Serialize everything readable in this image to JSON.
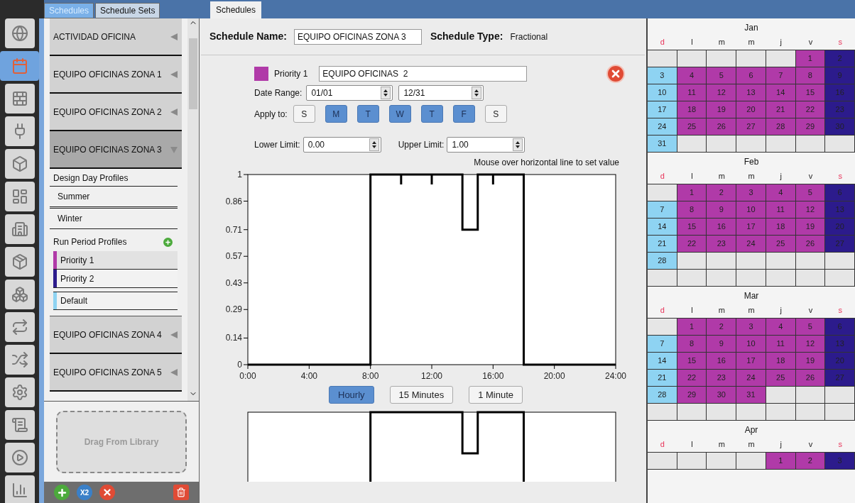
{
  "nav": [
    {
      "kind": "globe",
      "selected": false
    },
    {
      "kind": "calendar",
      "selected": true
    },
    {
      "kind": "bricks",
      "selected": false
    },
    {
      "kind": "outlet",
      "selected": false
    },
    {
      "kind": "cube",
      "selected": false
    },
    {
      "kind": "floorplan",
      "selected": false
    },
    {
      "kind": "building",
      "selected": false
    },
    {
      "kind": "box",
      "selected": false
    },
    {
      "kind": "boxes",
      "selected": false
    },
    {
      "kind": "loop",
      "selected": false
    },
    {
      "kind": "shuffle",
      "selected": false
    },
    {
      "kind": "gear",
      "selected": false
    },
    {
      "kind": "scroll",
      "selected": false
    },
    {
      "kind": "play",
      "selected": false
    },
    {
      "kind": "chart",
      "selected": false
    }
  ],
  "left_tabs": [
    {
      "label": "Schedules",
      "selected": true
    },
    {
      "label": "Schedule Sets",
      "selected": false
    }
  ],
  "main_tabs": [
    {
      "label": "Schedules",
      "selected": true
    }
  ],
  "schedules": [
    {
      "name": "ACTIVIDAD OFICINA",
      "expanded": false
    },
    {
      "name": "EQUIPO OFICINAS ZONA 1",
      "expanded": false
    },
    {
      "name": "EQUIPO OFICINAS ZONA 2",
      "expanded": false
    },
    {
      "name": "EQUIPO OFICINAS ZONA 3",
      "expanded": true,
      "design_day": {
        "label": "Design Day Profiles",
        "items": [
          "Summer",
          "Winter"
        ]
      },
      "run_period": {
        "label": "Run Period Profiles",
        "items": [
          {
            "label": "Priority 1",
            "color": "#b03aa8",
            "selected": true
          },
          {
            "label": "Priority 2",
            "color": "#2c1b8c",
            "selected": false
          },
          {
            "label": "Default",
            "color": "#8ed3f2",
            "selected": false
          }
        ]
      }
    },
    {
      "name": "EQUIPO OFICINAS ZONA 4",
      "expanded": false
    },
    {
      "name": "EQUIPO OFICINAS ZONA 5",
      "expanded": false
    }
  ],
  "library_drop": {
    "label": "Drag From Library"
  },
  "toolbar": [
    {
      "kind": "add"
    },
    {
      "kind": "copy",
      "label": "X2"
    },
    {
      "kind": "remove"
    },
    {
      "kind": "purge"
    }
  ],
  "editor": {
    "name_label": "Schedule Name:",
    "name_value": "EQUIPO OFICINAS ZONA 3",
    "type_label": "Schedule Type:",
    "type_value": "Fractional",
    "rule": {
      "color": "#b03aa8",
      "priority": "Priority 1",
      "name": "EQUIPO OFICINAS  2",
      "date_label": "Date Range:",
      "start": "01/01",
      "end": "12/31",
      "apply_label": "Apply to:",
      "days": [
        {
          "label": "S",
          "selected": false
        },
        {
          "label": "M",
          "selected": true
        },
        {
          "label": "T",
          "selected": true
        },
        {
          "label": "W",
          "selected": true
        },
        {
          "label": "T",
          "selected": true
        },
        {
          "label": "F",
          "selected": true
        },
        {
          "label": "S",
          "selected": false
        }
      ]
    },
    "lower_label": "Lower Limit:",
    "lower_value": "0.00",
    "upper_label": "Upper Limit:",
    "upper_value": "1.00",
    "hint": "Mouse over horizontal line to set value",
    "chart_data": {
      "type": "line",
      "x": [
        0,
        8,
        8,
        10,
        12,
        14,
        14,
        15,
        15,
        16,
        18,
        18,
        24
      ],
      "series": [
        {
          "color": "#000000",
          "values": [
            0,
            0,
            1,
            1,
            1,
            1,
            0.71,
            0.71,
            1,
            1,
            1,
            0,
            0
          ]
        }
      ],
      "xlim": [
        0,
        24
      ],
      "ylim": [
        0,
        1
      ],
      "xticks": [
        {
          "value": 0,
          "label": "0:00"
        },
        {
          "value": 4,
          "label": "4:00"
        },
        {
          "value": 8,
          "label": "8:00"
        },
        {
          "value": 12,
          "label": "12:00"
        },
        {
          "value": 16,
          "label": "16:00"
        },
        {
          "value": 20,
          "label": "20:00"
        },
        {
          "value": 24,
          "label": "24:00"
        }
      ],
      "yticks": [
        {
          "value": 0,
          "label": "0"
        },
        {
          "value": 0.14,
          "label": "0.14"
        },
        {
          "value": 0.29,
          "label": "0.29"
        },
        {
          "value": 0.43,
          "label": "0.43"
        },
        {
          "value": 0.57,
          "label": "0.57"
        },
        {
          "value": 0.71,
          "label": "0.71"
        },
        {
          "value": 0.86,
          "label": "0.86"
        },
        {
          "value": 1,
          "label": "1"
        }
      ]
    },
    "resolutions": [
      {
        "label": "Hourly",
        "selected": true
      },
      {
        "label": "15 Minutes",
        "selected": false
      },
      {
        "label": "1 Minute",
        "selected": false
      }
    ]
  },
  "calendar": [
    {
      "month": "Jan",
      "weekdays": [
        {
          "label": "d",
          "weekend": true
        },
        {
          "label": "l",
          "weekend": false
        },
        {
          "label": "m",
          "weekend": false
        },
        {
          "label": "m",
          "weekend": false
        },
        {
          "label": "j",
          "weekend": false
        },
        {
          "label": "v",
          "weekend": false
        },
        {
          "label": "s",
          "weekend": true
        }
      ],
      "weeks": [
        [
          {
            "kind": "empty"
          },
          {
            "kind": "empty"
          },
          {
            "kind": "empty"
          },
          {
            "kind": "empty"
          },
          {
            "kind": "empty"
          },
          {
            "kind": "day",
            "day": "1",
            "color": "#b03aa8"
          },
          {
            "kind": "day",
            "day": "2",
            "color": "#2c1b8c"
          }
        ],
        [
          {
            "kind": "day",
            "day": "3",
            "color": "#8ed3f2"
          },
          {
            "kind": "day",
            "day": "4",
            "color": "#b03aa8"
          },
          {
            "kind": "day",
            "day": "5",
            "color": "#b03aa8"
          },
          {
            "kind": "day",
            "day": "6",
            "color": "#b03aa8"
          },
          {
            "kind": "day",
            "day": "7",
            "color": "#b03aa8"
          },
          {
            "kind": "day",
            "day": "8",
            "color": "#b03aa8"
          },
          {
            "kind": "day",
            "day": "9",
            "color": "#2c1b8c"
          }
        ],
        [
          {
            "kind": "day",
            "day": "10",
            "color": "#8ed3f2"
          },
          {
            "kind": "day",
            "day": "11",
            "color": "#b03aa8"
          },
          {
            "kind": "day",
            "day": "12",
            "color": "#b03aa8"
          },
          {
            "kind": "day",
            "day": "13",
            "color": "#b03aa8"
          },
          {
            "kind": "day",
            "day": "14",
            "color": "#b03aa8"
          },
          {
            "kind": "day",
            "day": "15",
            "color": "#b03aa8"
          },
          {
            "kind": "day",
            "day": "16",
            "color": "#2c1b8c"
          }
        ],
        [
          {
            "kind": "day",
            "day": "17",
            "color": "#8ed3f2"
          },
          {
            "kind": "day",
            "day": "18",
            "color": "#b03aa8"
          },
          {
            "kind": "day",
            "day": "19",
            "color": "#b03aa8"
          },
          {
            "kind": "day",
            "day": "20",
            "color": "#b03aa8"
          },
          {
            "kind": "day",
            "day": "21",
            "color": "#b03aa8"
          },
          {
            "kind": "day",
            "day": "22",
            "color": "#b03aa8"
          },
          {
            "kind": "day",
            "day": "23",
            "color": "#2c1b8c"
          }
        ],
        [
          {
            "kind": "day",
            "day": "24",
            "color": "#8ed3f2"
          },
          {
            "kind": "day",
            "day": "25",
            "color": "#b03aa8"
          },
          {
            "kind": "day",
            "day": "26",
            "color": "#b03aa8"
          },
          {
            "kind": "day",
            "day": "27",
            "color": "#b03aa8"
          },
          {
            "kind": "day",
            "day": "28",
            "color": "#b03aa8"
          },
          {
            "kind": "day",
            "day": "29",
            "color": "#b03aa8"
          },
          {
            "kind": "day",
            "day": "30",
            "color": "#2c1b8c"
          }
        ],
        [
          {
            "kind": "day",
            "day": "31",
            "color": "#8ed3f2"
          },
          {
            "kind": "empty"
          },
          {
            "kind": "empty"
          },
          {
            "kind": "empty"
          },
          {
            "kind": "empty"
          },
          {
            "kind": "empty"
          },
          {
            "kind": "empty"
          }
        ]
      ]
    },
    {
      "month": "Feb",
      "weekdays": [
        {
          "label": "d",
          "weekend": true
        },
        {
          "label": "l",
          "weekend": false
        },
        {
          "label": "m",
          "weekend": false
        },
        {
          "label": "m",
          "weekend": false
        },
        {
          "label": "j",
          "weekend": false
        },
        {
          "label": "v",
          "weekend": false
        },
        {
          "label": "s",
          "weekend": true
        }
      ],
      "weeks": [
        [
          {
            "kind": "empty"
          },
          {
            "kind": "day",
            "day": "1",
            "color": "#b03aa8"
          },
          {
            "kind": "day",
            "day": "2",
            "color": "#b03aa8"
          },
          {
            "kind": "day",
            "day": "3",
            "color": "#b03aa8"
          },
          {
            "kind": "day",
            "day": "4",
            "color": "#b03aa8"
          },
          {
            "kind": "day",
            "day": "5",
            "color": "#b03aa8"
          },
          {
            "kind": "day",
            "day": "6",
            "color": "#2c1b8c"
          }
        ],
        [
          {
            "kind": "day",
            "day": "7",
            "color": "#8ed3f2"
          },
          {
            "kind": "day",
            "day": "8",
            "color": "#b03aa8"
          },
          {
            "kind": "day",
            "day": "9",
            "color": "#b03aa8"
          },
          {
            "kind": "day",
            "day": "10",
            "color": "#b03aa8"
          },
          {
            "kind": "day",
            "day": "11",
            "color": "#b03aa8"
          },
          {
            "kind": "day",
            "day": "12",
            "color": "#b03aa8"
          },
          {
            "kind": "day",
            "day": "13",
            "color": "#2c1b8c"
          }
        ],
        [
          {
            "kind": "day",
            "day": "14",
            "color": "#8ed3f2"
          },
          {
            "kind": "day",
            "day": "15",
            "color": "#b03aa8"
          },
          {
            "kind": "day",
            "day": "16",
            "color": "#b03aa8"
          },
          {
            "kind": "day",
            "day": "17",
            "color": "#b03aa8"
          },
          {
            "kind": "day",
            "day": "18",
            "color": "#b03aa8"
          },
          {
            "kind": "day",
            "day": "19",
            "color": "#b03aa8"
          },
          {
            "kind": "day",
            "day": "20",
            "color": "#2c1b8c"
          }
        ],
        [
          {
            "kind": "day",
            "day": "21",
            "color": "#8ed3f2"
          },
          {
            "kind": "day",
            "day": "22",
            "color": "#b03aa8"
          },
          {
            "kind": "day",
            "day": "23",
            "color": "#b03aa8"
          },
          {
            "kind": "day",
            "day": "24",
            "color": "#b03aa8"
          },
          {
            "kind": "day",
            "day": "25",
            "color": "#b03aa8"
          },
          {
            "kind": "day",
            "day": "26",
            "color": "#b03aa8"
          },
          {
            "kind": "day",
            "day": "27",
            "color": "#2c1b8c"
          }
        ],
        [
          {
            "kind": "day",
            "day": "28",
            "color": "#8ed3f2"
          },
          {
            "kind": "empty"
          },
          {
            "kind": "empty"
          },
          {
            "kind": "empty"
          },
          {
            "kind": "empty"
          },
          {
            "kind": "empty"
          },
          {
            "kind": "empty"
          }
        ],
        [
          {
            "kind": "empty"
          },
          {
            "kind": "empty"
          },
          {
            "kind": "empty"
          },
          {
            "kind": "empty"
          },
          {
            "kind": "empty"
          },
          {
            "kind": "empty"
          },
          {
            "kind": "empty"
          }
        ]
      ]
    },
    {
      "month": "Mar",
      "weekdays": [
        {
          "label": "d",
          "weekend": true
        },
        {
          "label": "l",
          "weekend": false
        },
        {
          "label": "m",
          "weekend": false
        },
        {
          "label": "m",
          "weekend": false
        },
        {
          "label": "j",
          "weekend": false
        },
        {
          "label": "v",
          "weekend": false
        },
        {
          "label": "s",
          "weekend": true
        }
      ],
      "weeks": [
        [
          {
            "kind": "empty"
          },
          {
            "kind": "day",
            "day": "1",
            "color": "#b03aa8"
          },
          {
            "kind": "day",
            "day": "2",
            "color": "#b03aa8"
          },
          {
            "kind": "day",
            "day": "3",
            "color": "#b03aa8"
          },
          {
            "kind": "day",
            "day": "4",
            "color": "#b03aa8"
          },
          {
            "kind": "day",
            "day": "5",
            "color": "#b03aa8"
          },
          {
            "kind": "day",
            "day": "6",
            "color": "#2c1b8c"
          }
        ],
        [
          {
            "kind": "day",
            "day": "7",
            "color": "#8ed3f2"
          },
          {
            "kind": "day",
            "day": "8",
            "color": "#b03aa8"
          },
          {
            "kind": "day",
            "day": "9",
            "color": "#b03aa8"
          },
          {
            "kind": "day",
            "day": "10",
            "color": "#b03aa8"
          },
          {
            "kind": "day",
            "day": "11",
            "color": "#b03aa8"
          },
          {
            "kind": "day",
            "day": "12",
            "color": "#b03aa8"
          },
          {
            "kind": "day",
            "day": "13",
            "color": "#2c1b8c"
          }
        ],
        [
          {
            "kind": "day",
            "day": "14",
            "color": "#8ed3f2"
          },
          {
            "kind": "day",
            "day": "15",
            "color": "#b03aa8"
          },
          {
            "kind": "day",
            "day": "16",
            "color": "#b03aa8"
          },
          {
            "kind": "day",
            "day": "17",
            "color": "#b03aa8"
          },
          {
            "kind": "day",
            "day": "18",
            "color": "#b03aa8"
          },
          {
            "kind": "day",
            "day": "19",
            "color": "#b03aa8"
          },
          {
            "kind": "day",
            "day": "20",
            "color": "#2c1b8c"
          }
        ],
        [
          {
            "kind": "day",
            "day": "21",
            "color": "#8ed3f2"
          },
          {
            "kind": "day",
            "day": "22",
            "color": "#b03aa8"
          },
          {
            "kind": "day",
            "day": "23",
            "color": "#b03aa8"
          },
          {
            "kind": "day",
            "day": "24",
            "color": "#b03aa8"
          },
          {
            "kind": "day",
            "day": "25",
            "color": "#b03aa8"
          },
          {
            "kind": "day",
            "day": "26",
            "color": "#b03aa8"
          },
          {
            "kind": "day",
            "day": "27",
            "color": "#2c1b8c"
          }
        ],
        [
          {
            "kind": "day",
            "day": "28",
            "color": "#8ed3f2"
          },
          {
            "kind": "day",
            "day": "29",
            "color": "#b03aa8"
          },
          {
            "kind": "day",
            "day": "30",
            "color": "#b03aa8"
          },
          {
            "kind": "day",
            "day": "31",
            "color": "#b03aa8"
          },
          {
            "kind": "empty"
          },
          {
            "kind": "empty"
          },
          {
            "kind": "empty"
          }
        ],
        [
          {
            "kind": "empty"
          },
          {
            "kind": "empty"
          },
          {
            "kind": "empty"
          },
          {
            "kind": "empty"
          },
          {
            "kind": "empty"
          },
          {
            "kind": "empty"
          },
          {
            "kind": "empty"
          }
        ]
      ]
    },
    {
      "month": "Apr",
      "weekdays": [
        {
          "label": "d",
          "weekend": true
        },
        {
          "label": "l",
          "weekend": false
        },
        {
          "label": "m",
          "weekend": false
        },
        {
          "label": "m",
          "weekend": false
        },
        {
          "label": "j",
          "weekend": false
        },
        {
          "label": "v",
          "weekend": false
        },
        {
          "label": "s",
          "weekend": true
        }
      ],
      "weeks": [
        [
          {
            "kind": "empty"
          },
          {
            "kind": "empty"
          },
          {
            "kind": "empty"
          },
          {
            "kind": "empty"
          },
          {
            "kind": "day",
            "day": "1",
            "color": "#b03aa8"
          },
          {
            "kind": "day",
            "day": "2",
            "color": "#b03aa8"
          },
          {
            "kind": "day",
            "day": "3",
            "color": "#2c1b8c"
          }
        ]
      ]
    }
  ]
}
